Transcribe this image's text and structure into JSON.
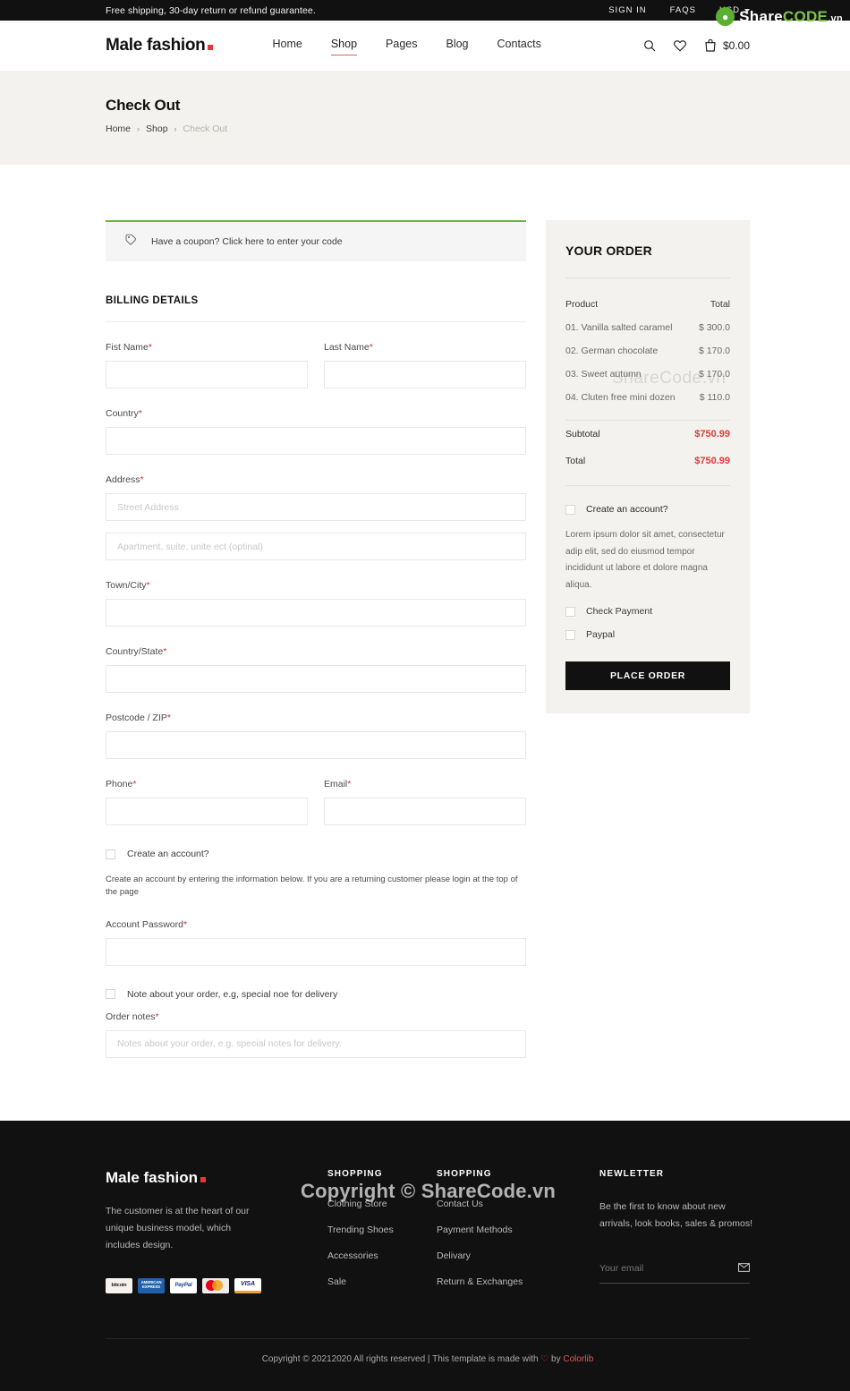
{
  "topbar": {
    "promo": "Free shipping, 30-day return or refund guarantee.",
    "sign_in": "SIGN IN",
    "faqs": "FAQS",
    "currency": "USD",
    "caret_icon": "chevron-down-icon"
  },
  "header": {
    "logo": "Male fashion",
    "nav": [
      {
        "label": "Home",
        "active": false
      },
      {
        "label": "Shop",
        "active": true
      },
      {
        "label": "Pages",
        "active": false
      },
      {
        "label": "Blog",
        "active": false
      },
      {
        "label": "Contacts",
        "active": false
      }
    ],
    "search_icon": "search-icon",
    "wishlist_icon": "heart-icon",
    "cart_icon": "shopping-bag-icon",
    "cart_total": "$0.00"
  },
  "breadcrumb": {
    "title": "Check Out",
    "items": [
      "Home",
      "Shop",
      "Check Out"
    ],
    "separator": "›"
  },
  "coupon": {
    "icon": "tag-icon",
    "text": "Have a coupon? Click here to enter your code",
    "accent_color": "#6eb341"
  },
  "billing": {
    "section_title": "BILLING DETAILS",
    "fields": {
      "first_name": {
        "label": "Fist Name",
        "required": true,
        "value": "",
        "placeholder": ""
      },
      "last_name": {
        "label": "Last Name",
        "required": true,
        "value": "",
        "placeholder": ""
      },
      "country": {
        "label": "Country",
        "required": true,
        "value": "",
        "placeholder": ""
      },
      "address": {
        "label": "Address",
        "required": true,
        "value": "",
        "placeholder": "Street Address"
      },
      "address2": {
        "label": "",
        "required": false,
        "value": "",
        "placeholder": "Apartment, suite, unite ect (optinal)"
      },
      "town_city": {
        "label": "Town/City",
        "required": true,
        "value": "",
        "placeholder": ""
      },
      "country_state": {
        "label": "Country/State",
        "required": true,
        "value": "",
        "placeholder": ""
      },
      "postcode": {
        "label": "Postcode / ZIP",
        "required": true,
        "value": "",
        "placeholder": ""
      },
      "phone": {
        "label": "Phone",
        "required": true,
        "value": "",
        "placeholder": ""
      },
      "email": {
        "label": "Email",
        "required": true,
        "value": "",
        "placeholder": ""
      },
      "account_password": {
        "label": "Account Password",
        "required": true,
        "value": "",
        "placeholder": ""
      },
      "order_notes": {
        "label": "Order notes",
        "required": true,
        "value": "",
        "placeholder": "Notes about your order, e.g. special notes for delivery."
      }
    },
    "create_account_label": "Create an account?",
    "create_account_help": "Create an account by entering the information below. If you are a returning customer please login at the top of the page",
    "note_checkbox_label": "Note about your order, e.g, special noe for delivery"
  },
  "order": {
    "title": "YOUR ORDER",
    "col_product": "Product",
    "col_total": "Total",
    "items": [
      {
        "name": "01. Vanilla salted caramel",
        "price": "$ 300.0"
      },
      {
        "name": "02. German chocolate",
        "price": "$ 170.0"
      },
      {
        "name": "03. Sweet autumn",
        "price": "$ 170.0"
      },
      {
        "name": "04. Cluten free mini dozen",
        "price": "$ 110.0"
      }
    ],
    "subtotal_label": "Subtotal",
    "subtotal_value": "$750.99",
    "total_label": "Total",
    "total_value": "$750.99",
    "total_color": "#e03a3a",
    "create_account_label": "Create an account?",
    "lorem": "Lorem ipsum dolor sit amet, consectetur adip elit, sed do eiusmod tempor incididunt ut labore et dolore magna aliqua.",
    "payment_options": [
      "Check Payment",
      "Paypal"
    ],
    "place_order_label": "PLACE ORDER"
  },
  "footer": {
    "logo": "Male fashion",
    "description": "The customer is at the heart of our unique business model, which includes design.",
    "payment_cards": [
      {
        "name": "bitcoin-card-icon",
        "label": "bitcoin"
      },
      {
        "name": "amex-card-icon",
        "label": "AMERICAN EXPRESS"
      },
      {
        "name": "paypal-card-icon",
        "label": "PayPal"
      },
      {
        "name": "mastercard-card-icon",
        "label": ""
      },
      {
        "name": "visa-card-icon",
        "label": "VISA"
      }
    ],
    "columns": [
      {
        "title": "SHOPPING",
        "links": [
          "Clothing Store",
          "Trending Shoes",
          "Accessories",
          "Sale"
        ]
      },
      {
        "title": "SHOPPING",
        "links": [
          "Contact Us",
          "Payment Methods",
          "Delivary",
          "Return & Exchanges"
        ]
      }
    ],
    "newsletter": {
      "title": "NEWLETTER",
      "text": "Be the first to know about new arrivals, look books, sales & promos!",
      "placeholder": "Your email",
      "value": "",
      "submit_icon": "envelope-icon"
    },
    "copyright_pre": "Copyright © 20212020 All rights reserved | This template is made with ",
    "copyright_heart": "♡",
    "copyright_mid": " by ",
    "copyright_brand": "Colorlib"
  },
  "watermark": {
    "share": "Share",
    "code": "CODE",
    "vn": ".vn",
    "mid": "ShareCode.vn",
    "big": "Copyright © ShareCode.vn"
  }
}
